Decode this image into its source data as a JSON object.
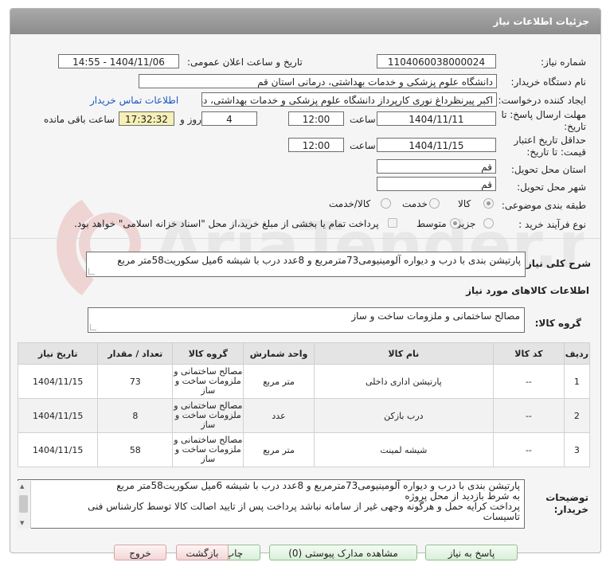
{
  "header": {
    "title": "جزئیات اطلاعات نیاز"
  },
  "fields": {
    "need_number_label": "شماره نیاز:",
    "need_number": "1104060038000024",
    "announce_label": "تاریخ و ساعت اعلان عمومی:",
    "announce_value": "1404/11/06 - 14:55",
    "buyer_org_label": "نام دستگاه خریدار:",
    "buyer_org": "دانشگاه علوم پزشکی و خدمات بهداشتی، درمانی استان قم",
    "requester_label": "ایجاد کننده درخواست:",
    "requester": "اکبر پیرنظرداغ نوری کارپرداز دانشگاه علوم پزشکی و خدمات بهداشتی، درمانی ا",
    "contact_link": "اطلاعات تماس خریدار",
    "send_deadline_label_1": "مهلت ارسال پاسخ: تا",
    "send_deadline_label_2": "تاریخ:",
    "send_date": "1404/11/11",
    "time_label": "ساعت",
    "send_time": "12:00",
    "days": "4",
    "days_label": "روز و",
    "remaining": "17:32:32",
    "remaining_label": "ساعت باقی مانده",
    "validity_label_1": "حداقل تاریخ اعتبار",
    "validity_label_2": "قیمت: تا تاریخ:",
    "validity_date": "1404/11/15",
    "validity_time": "12:00",
    "province_label": "استان محل تحویل:",
    "province": "قم",
    "city_label": "شهر محل تحویل:",
    "city": "قم",
    "category_label": "طبقه بندی موضوعی:",
    "category_options": [
      "کالا",
      "خدمت",
      "کالا/خدمت"
    ],
    "process_label": "نوع فرآیند خرید :",
    "process_options": [
      "جزیی",
      "متوسط"
    ],
    "payment_note": "پرداخت تمام یا بخشی از مبلغ خرید،از محل \"اسناد خزانه اسلامی\" خواهد بود."
  },
  "description": {
    "label": "شرح کلی نیاز:",
    "value": "پارتیشن بندی با درب و دیواره آلومینیومی73مترمربع و 8عدد درب با شیشه 6میل سکوریت58متر مربع"
  },
  "goods_section": {
    "title": "اطلاعات کالاهای مورد نیاز",
    "group_label": "گروه کالا:",
    "group_value": "مصالح ساختمانی و ملزومات ساخت و ساز"
  },
  "table": {
    "headers": [
      "ردیف",
      "کد کالا",
      "نام کالا",
      "واحد شمارش",
      "گروه کالا",
      "تعداد / مقدار",
      "تاریخ نیاز"
    ],
    "rows": [
      {
        "idx": "1",
        "code": "--",
        "name": "پارتیشن اداری داخلی",
        "unit": "متر مربع",
        "group": "مصالح ساختمانی و ملزومات ساخت و ساز",
        "qty": "73",
        "date": "1404/11/15"
      },
      {
        "idx": "2",
        "code": "--",
        "name": "درب بازکن",
        "unit": "عدد",
        "group": "مصالح ساختمانی و ملزومات ساخت و ساز",
        "qty": "8",
        "date": "1404/11/15"
      },
      {
        "idx": "3",
        "code": "--",
        "name": "شیشه لمینت",
        "unit": "متر مربع",
        "group": "مصالح ساختمانی و ملزومات ساخت و ساز",
        "qty": "58",
        "date": "1404/11/15"
      }
    ]
  },
  "buyer_notes": {
    "label_1": "توضیحات",
    "label_2": "خریدار:",
    "lines": [
      "پارتیشن بندی با درب و دیواره آلومینیومی73مترمربع و 8عدد درب با شیشه 6میل سکوریت58متر مربع",
      "به شرط بازدید از محل پروژه",
      "پرداخت کرایه حمل و هرگونه وجهی غیر از سامانه نباشد   پرداخت پس از تایید اصالت کالا توسط کارشناس فنی",
      "تاسیسات"
    ]
  },
  "buttons": {
    "reply": "پاسخ به نیاز",
    "docs": "مشاهده مدارک پیوستی (0)",
    "print": "چاپ",
    "back": "بازگشت",
    "exit": "خروج"
  },
  "watermark": "AriaTender.neT",
  "colors": {
    "link": "#1a57c4",
    "header": "#999999",
    "remaining_bg": "#f6efb7"
  }
}
